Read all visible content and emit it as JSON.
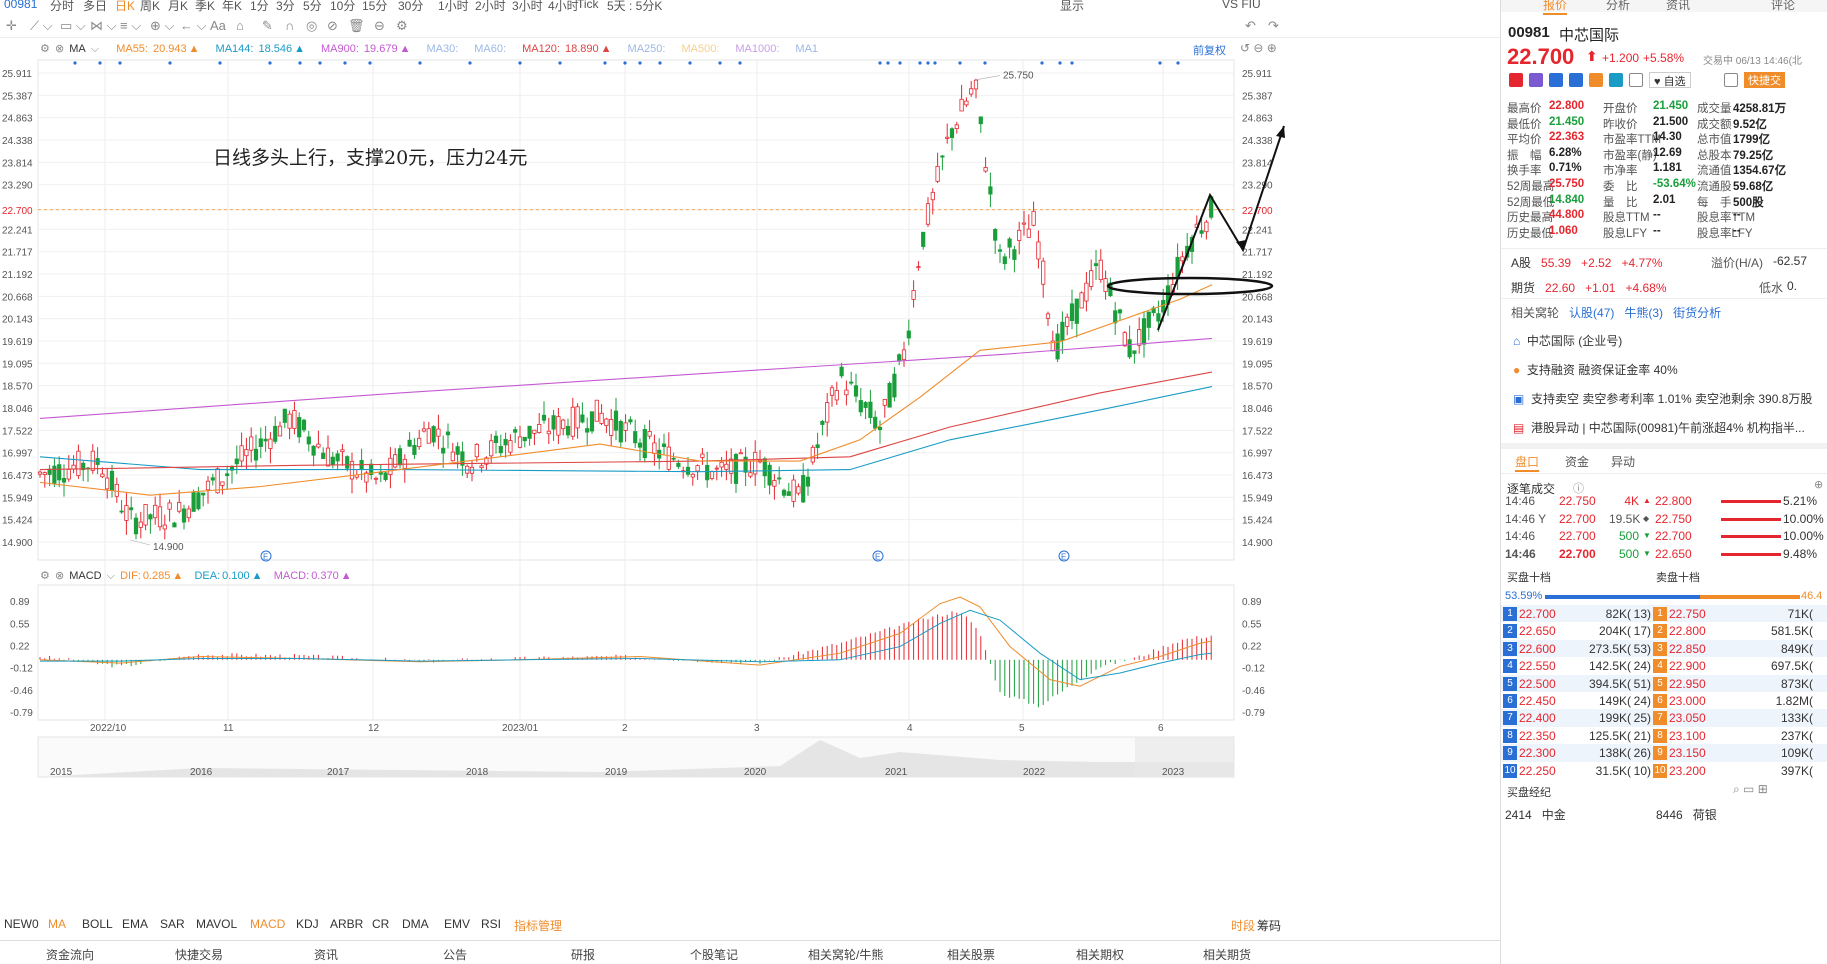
{
  "topbar": {
    "code": "00981",
    "periods": [
      "分时",
      "多日",
      "日K",
      "周K",
      "月K",
      "季K",
      "年K",
      "1分",
      "3分",
      "5分",
      "10分",
      "15分",
      "30分",
      "1小时",
      "2小时",
      "3小时",
      "4小时",
      "Tick",
      "5天 : 5分K"
    ],
    "active_period": "日K",
    "right_items": [
      "显示",
      "VS FIU"
    ]
  },
  "legend": {
    "ma_label": "MA",
    "items": [
      {
        "label": "MA55:",
        "value": "20.943",
        "color": "#f08c2a"
      },
      {
        "label": "MA144:",
        "value": "18.546",
        "color": "#1a9bc4"
      },
      {
        "label": "MA900:",
        "value": "19.679",
        "color": "#c45ad1"
      },
      {
        "label": "MA30:",
        "value": "",
        "color": "#9bb8e6"
      },
      {
        "label": "MA60:",
        "value": "",
        "color": "#9bb8e6"
      },
      {
        "label": "MA120:",
        "value": "18.890",
        "color": "#d44"
      },
      {
        "label": "MA250:",
        "value": "",
        "color": "#9bb8e6"
      },
      {
        "label": "MA500:",
        "value": "",
        "color": "#f7d08a"
      },
      {
        "label": "MA1000:",
        "value": "",
        "color": "#c9a0e6"
      },
      {
        "label": "MA1",
        "value": "",
        "color": "#9bb8e6"
      }
    ],
    "adjust": "前复权"
  },
  "price_axis": [
    "25.911",
    "25.387",
    "24.863",
    "24.338",
    "23.814",
    "23.290",
    "22.700",
    "22.241",
    "21.717",
    "21.192",
    "20.668",
    "20.143",
    "19.619",
    "19.095",
    "18.570",
    "18.046",
    "17.522",
    "16.997",
    "16.473",
    "15.949",
    "15.424",
    "14.900"
  ],
  "price_annotations": {
    "high": "25.750",
    "low": "14.900",
    "current": "22.700"
  },
  "annotation_text": "日线多头上行，支撑20元，压力24元",
  "macd_legend": {
    "label": "MACD",
    "dif_label": "DIF:",
    "dif": "0.285",
    "dea_label": "DEA:",
    "dea": "0.100",
    "macd_label": "MACD:",
    "macd": "0.370"
  },
  "macd_axis": [
    "0.89",
    "0.55",
    "0.22",
    "-0.12",
    "-0.46",
    "-0.79"
  ],
  "date_axis": [
    "2022/10",
    "11",
    "12",
    "2023/01",
    "2",
    "3",
    "4",
    "5",
    "6"
  ],
  "overview_years": [
    "2015",
    "2016",
    "2017",
    "2018",
    "2019",
    "2020",
    "2021",
    "2022",
    "2023"
  ],
  "indicator_tabs": [
    "NEW0",
    "MA",
    "BOLL",
    "EMA",
    "SAR",
    "MAVOL",
    "MACD",
    "KDJ",
    "ARBR",
    "CR",
    "DMA",
    "EMV",
    "RSI",
    "指标管理"
  ],
  "indicator_right": [
    "时段",
    "筹码"
  ],
  "bottom_nav": [
    "资金流向",
    "快捷交易",
    "资讯",
    "公告",
    "研报",
    "个股笔记",
    "相关窝轮/牛熊",
    "相关股票",
    "相关期权",
    "相关期货"
  ],
  "right": {
    "tabs": [
      "报价",
      "分析",
      "资讯",
      "评论"
    ],
    "code": "00981",
    "name": "中芯国际",
    "price": "22.700",
    "change": "+1.200",
    "change_pct": "+5.58%",
    "time": "交易中 06/13 14:46(北",
    "watch_label": "自选",
    "quick_trade": "快捷交",
    "quote": [
      [
        "最高价",
        "22.800",
        "开盘价",
        "21.450",
        "成交量",
        "4258.81万"
      ],
      [
        "最低价",
        "21.450",
        "昨收价",
        "21.500",
        "成交额",
        "9.52亿"
      ],
      [
        "平均价",
        "22.363",
        "市盈率TTM",
        "14.30",
        "总市值",
        "1799亿"
      ],
      [
        "振　幅",
        "6.28%",
        "市盈率(静)",
        "12.69",
        "总股本",
        "79.25亿"
      ],
      [
        "换手率",
        "0.71%",
        "市净率",
        "1.181",
        "流通值",
        "1354.67亿"
      ],
      [
        "52周最高",
        "25.750",
        "委　比",
        "-53.64%",
        "流通股",
        "59.68亿"
      ],
      [
        "52周最低",
        "14.840",
        "量　比",
        "2.01",
        "每　手",
        "500股"
      ],
      [
        "历史最高",
        "44.800",
        "股息TTM",
        "--",
        "股息率TTM",
        "--"
      ],
      [
        "历史最低",
        "1.060",
        "股息LFY",
        "--",
        "股息率LFY",
        "--"
      ]
    ],
    "a_share": {
      "label": "A股",
      "price": "55.39",
      "change": "+2.52",
      "pct": "+4.77%",
      "premium_label": "溢价(H/A)",
      "premium": "-62.57"
    },
    "futures": {
      "label": "期货",
      "price": "22.60",
      "change": "+1.01",
      "pct": "+4.68%",
      "basis_label": "低水",
      "basis": "0."
    },
    "related_tabs": [
      "相关窝轮",
      "认股(47)",
      "牛熊(3)",
      "街货分析"
    ],
    "info_rows": [
      "中芯国际 (企业号)",
      "支持融资 融资保证金率 40%",
      "支持卖空 卖空参考利率 1.01% 卖空池剩余 390.8万股",
      "港股异动 | 中芯国际(00981)午前涨超4% 机构指半..."
    ],
    "panel_tabs": [
      "盘口",
      "资金",
      "异动"
    ],
    "ticks_title": "逐笔成交",
    "ticks": [
      {
        "time": "14:46",
        "price": "22.750",
        "vol": "4K",
        "dir": "▲"
      },
      {
        "time": "14:46 Y",
        "price": "22.700",
        "vol": "19.5K",
        "dir": "◆"
      },
      {
        "time": "14:46",
        "price": "22.700",
        "vol": "500",
        "dir": "▼"
      },
      {
        "time": "14:46",
        "price": "22.700",
        "vol": "500",
        "dir": "▼"
      }
    ],
    "depth_right": [
      {
        "price": "22.800",
        "pct": "5.21%"
      },
      {
        "price": "22.750",
        "pct": "10.00%"
      },
      {
        "price": "22.700",
        "pct": "10.00%"
      },
      {
        "price": "22.650",
        "pct": "9.48%"
      }
    ],
    "bid_title": "买盘十档",
    "ask_title": "卖盘十档",
    "bid_ratio": "53.59%",
    "ask_ratio": "46.4",
    "orderbook": [
      {
        "n": "1",
        "bid": "22.700",
        "bvol": "82K(",
        "bc": "13)",
        "ask": "22.750",
        "avol": "71K("
      },
      {
        "n": "2",
        "bid": "22.650",
        "bvol": "204K(",
        "bc": "17)",
        "ask": "22.800",
        "avol": "581.5K("
      },
      {
        "n": "3",
        "bid": "22.600",
        "bvol": "273.5K(",
        "bc": "53)",
        "ask": "22.850",
        "avol": "849K("
      },
      {
        "n": "4",
        "bid": "22.550",
        "bvol": "142.5K(",
        "bc": "24)",
        "ask": "22.900",
        "avol": "697.5K("
      },
      {
        "n": "5",
        "bid": "22.500",
        "bvol": "394.5K(",
        "bc": "51)",
        "ask": "22.950",
        "avol": "873K("
      },
      {
        "n": "6",
        "bid": "22.450",
        "bvol": "149K(",
        "bc": "24)",
        "ask": "23.000",
        "avol": "1.82M("
      },
      {
        "n": "7",
        "bid": "22.400",
        "bvol": "199K(",
        "bc": "25)",
        "ask": "23.050",
        "avol": "133K("
      },
      {
        "n": "8",
        "bid": "22.350",
        "bvol": "125.5K(",
        "bc": "21)",
        "ask": "23.100",
        "avol": "237K("
      },
      {
        "n": "9",
        "bid": "22.300",
        "bvol": "138K(",
        "bc": "26)",
        "ask": "23.150",
        "avol": "109K("
      },
      {
        "n": "10",
        "bid": "22.250",
        "bvol": "31.5K(",
        "bc": "10)",
        "ask": "23.200",
        "avol": "397K("
      }
    ],
    "brokers_title": "买盘经纪",
    "brokers": [
      {
        "id": "2414",
        "name": "中金"
      },
      {
        "id": "8446",
        "name": "荷银"
      }
    ]
  },
  "colors": {
    "up": "#e6262e",
    "down": "#1a9e3b",
    "ma55": "#f08c2a",
    "ma144": "#1a9bc4",
    "ma900": "#c45ad1",
    "ma120": "#d44",
    "accent": "#2a6fd6"
  }
}
